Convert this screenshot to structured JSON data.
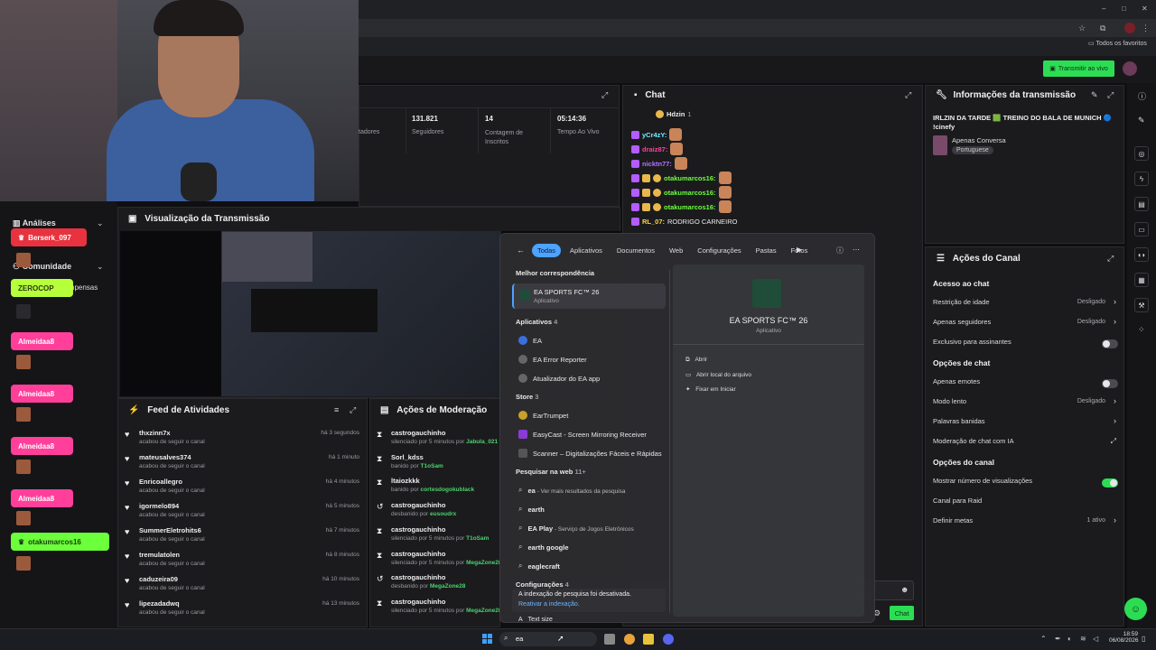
{
  "browser": {
    "favorites_label": "Todos os favoritos"
  },
  "topbar": {
    "live_button": "Transmitir ao vivo"
  },
  "sidebar": {
    "analytics_label": "Análises",
    "community_label": "Comunidade",
    "partial_label": "npensas",
    "tags": [
      {
        "label": "Berserk_097",
        "color": "#e8323f"
      },
      {
        "label": "ZEROCOP",
        "color": "#b6ff3b"
      },
      {
        "label": "Almeidaa8",
        "color": "#ff3f9a"
      },
      {
        "label": "Almeidaa8",
        "color": "#ff3f9a"
      },
      {
        "label": "Almeidaa8",
        "color": "#ff3f9a"
      },
      {
        "label": "Almeidaa8",
        "color": "#ff3f9a"
      },
      {
        "label": "otakumarcos16",
        "color": "#6cff3b"
      }
    ]
  },
  "stats": {
    "items": [
      {
        "value": "",
        "label": "tadores"
      },
      {
        "value": "131.821",
        "label": "Seguidores"
      },
      {
        "value": "14",
        "label": "Contagem de Inscritos"
      },
      {
        "value": "05:14:36",
        "label": "Tempo Ao Vivo"
      }
    ]
  },
  "preview": {
    "title": "Visualização da Transmissão"
  },
  "feed": {
    "title": "Feed de Atividades",
    "items": [
      {
        "name": "thxzinn7x",
        "action": "acabou de seguir o canal",
        "time": "há 3 segundos"
      },
      {
        "name": "mateusalves374",
        "action": "acabou de seguir o canal",
        "time": "há 1 minuto"
      },
      {
        "name": "Enricoallegro",
        "action": "acabou de seguir o canal",
        "time": "há 4 minutos"
      },
      {
        "name": "igormelo894",
        "action": "acabou de seguir o canal",
        "time": "há 5 minutos"
      },
      {
        "name": "SummerEletrohits6",
        "action": "acabou de seguir o canal",
        "time": "há 7 minutos"
      },
      {
        "name": "tremulatolen",
        "action": "acabou de seguir o canal",
        "time": "há 8 minutos"
      },
      {
        "name": "caduzeira09",
        "action": "acabou de seguir o canal",
        "time": "há 10 minutos"
      },
      {
        "name": "lipezadadwq",
        "action": "acabou de seguir o canal",
        "time": "há 13 minutos"
      }
    ]
  },
  "moderation": {
    "title": "Ações de Moderação",
    "items": [
      {
        "name": "castrogauchinho",
        "action": "silenciado por 5 minutos por",
        "by": "Jabula_021"
      },
      {
        "name": "Sorl_kdss",
        "action": "banido por",
        "by": "T1oSam"
      },
      {
        "name": "ltaiozkkk",
        "action": "banido por",
        "by": "cortesdogokublack"
      },
      {
        "name": "castrogauchinho",
        "action": "desbanido por",
        "by": "eusoudrx"
      },
      {
        "name": "castrogauchinho",
        "action": "silenciado por 5 minutos por",
        "by": "T1oSam"
      },
      {
        "name": "castrogauchinho",
        "action": "silenciado por 5 minutos por",
        "by": "MegaZone28"
      },
      {
        "name": "castrogauchinho",
        "action": "desbanido por",
        "by": "MegaZone28"
      },
      {
        "name": "castrogauchinho",
        "action": "silenciado por 5 minutos por",
        "by": "MegaZone28"
      }
    ]
  },
  "chat": {
    "title": "Chat",
    "pinned_user": "Hdzin",
    "pinned_count": "1",
    "lines": [
      {
        "user": "yCr4zY:",
        "color": "#6cf0ff"
      },
      {
        "user": "draiz87:",
        "color": "#ff3f9a"
      },
      {
        "user": "nicktn77:",
        "color": "#b473ff"
      },
      {
        "user": "otakumarcos16:",
        "color": "#6cff3b"
      },
      {
        "user": "otakumarcos16:",
        "color": "#6cff3b"
      },
      {
        "user": "otakumarcos16:",
        "color": "#6cff3b"
      },
      {
        "user": "RL_07:",
        "color": "#ffd43b",
        "text": "RODRIGO CARNEIRO"
      }
    ],
    "send_button": "Chat"
  },
  "info": {
    "title": "Informações da transmissão",
    "stream_title": "IRLZIN DA TARDE 🟩 TREINO DO BALA DE MUNICH 🔵 !cinefy",
    "category": "Apenas Conversa",
    "language": "Portuguese"
  },
  "channel_actions": {
    "title": "Ações do Canal",
    "sections": [
      {
        "title": "Acesso ao chat",
        "rows": [
          {
            "label": "Restrição de idade",
            "value": "Desligado",
            "control": "chevron"
          },
          {
            "label": "Apenas seguidores",
            "value": "Desligado",
            "control": "chevron"
          },
          {
            "label": "Exclusivo para assinantes",
            "value": "",
            "control": "toggle-off"
          }
        ]
      },
      {
        "title": "Opções de chat",
        "rows": [
          {
            "label": "Apenas emotes",
            "value": "",
            "control": "toggle-off"
          },
          {
            "label": "Modo lento",
            "value": "Desligado",
            "control": "chevron"
          },
          {
            "label": "Palavras banidas",
            "value": "",
            "control": "chevron"
          },
          {
            "label": "Moderação de chat com IA",
            "value": "",
            "control": "external"
          }
        ]
      },
      {
        "title": "Opções do canal",
        "rows": [
          {
            "label": "Mostrar número de visualizações",
            "value": "",
            "control": "toggle-on"
          },
          {
            "label": "Canal para Raid",
            "value": "",
            "control": "none"
          },
          {
            "label": "Definir metas",
            "value": "1 ativo",
            "control": "chevron"
          }
        ]
      }
    ]
  },
  "windows_search": {
    "tabs": [
      "Todas",
      "Aplicativos",
      "Documentos",
      "Web",
      "Configurações",
      "Pastas",
      "Fotos"
    ],
    "best_match_heading": "Melhor correspondência",
    "best_match_name": "EA SPORTS FC™ 26",
    "best_match_type": "Aplicativo",
    "apps_heading": "Aplicativos",
    "apps_count": "4",
    "apps": [
      "EA",
      "EA Error Reporter",
      "Atualizador do EA app"
    ],
    "store_heading": "Store",
    "store_count": "3",
    "store": [
      "EarTrumpet",
      "EasyCast - Screen Mirroring Receiver",
      "Scanner – Digitalizações Fáceis e Rápidas"
    ],
    "web_heading": "Pesquisar na web",
    "web_count": "11+",
    "web": [
      {
        "bold": "ea",
        "rest": " - Ver mais resultados da pesquisa"
      },
      {
        "bold": "earth",
        "rest": ""
      },
      {
        "bold": "EA Play",
        "rest": " - Serviço de Jogos Eletrônicos"
      },
      {
        "bold": "earth google",
        "rest": ""
      },
      {
        "bold": "eaglecraft",
        "rest": ""
      }
    ],
    "settings_heading": "Configurações",
    "settings_count": "4",
    "notice": "A indexação de pesquisa foi desativada.",
    "notice_link": "Reativar a indexação.",
    "text_size": "Text size",
    "detail_title": "EA SPORTS FC™ 26",
    "detail_type": "Aplicativo",
    "actions": [
      "Abrir",
      "Abrir local do arquivo",
      "Fixar em Iniciar"
    ]
  },
  "taskbar": {
    "search_text": "ea",
    "time": "18:59",
    "date": "06/08/2026"
  }
}
